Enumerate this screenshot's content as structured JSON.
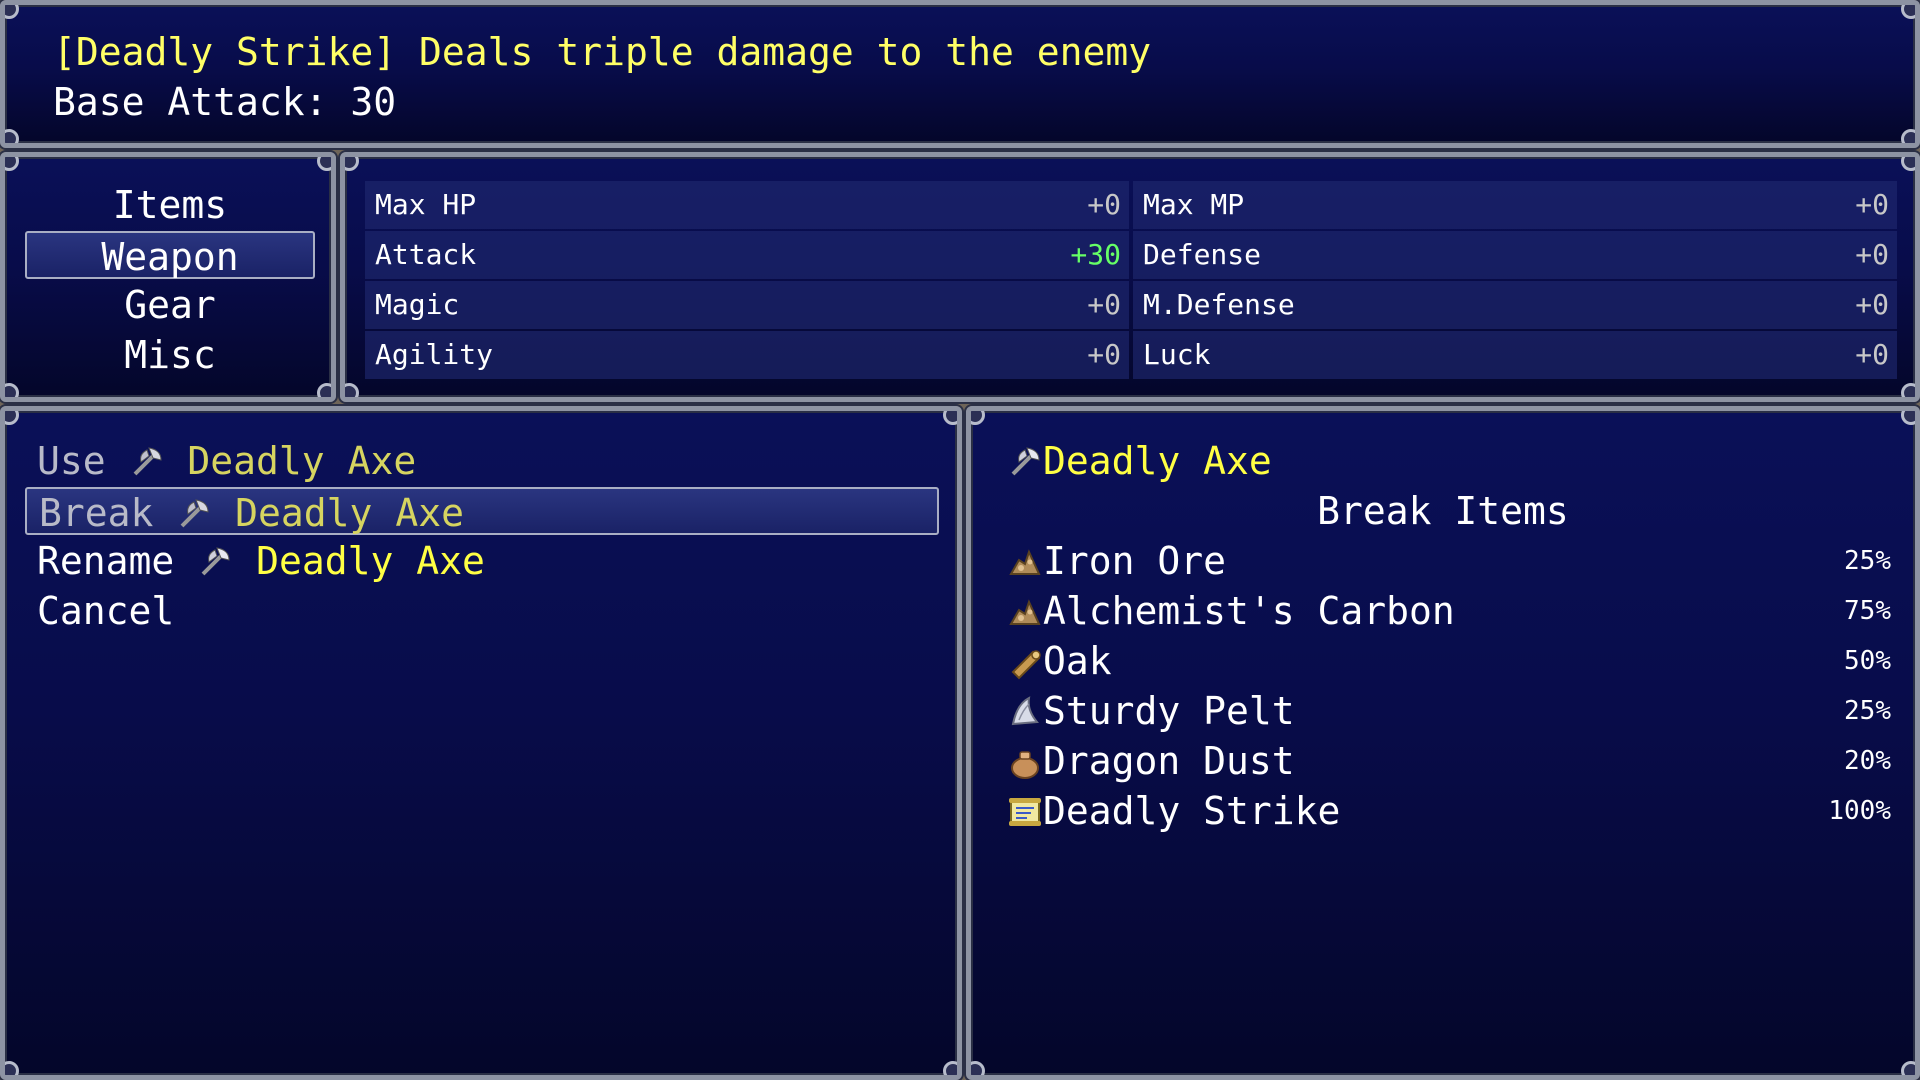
{
  "help": {
    "line1": "[Deadly Strike] Deals triple damage to the enemy",
    "line2": "Base Attack: 30"
  },
  "categories": [
    {
      "label": "Items",
      "selected": false
    },
    {
      "label": "Weapon",
      "selected": true
    },
    {
      "label": "Gear",
      "selected": false
    },
    {
      "label": "Misc",
      "selected": false
    }
  ],
  "stats": [
    {
      "name": "Max HP",
      "value": "+0"
    },
    {
      "name": "Max MP",
      "value": "+0"
    },
    {
      "name": "Attack",
      "value": "+30"
    },
    {
      "name": "Defense",
      "value": "+0"
    },
    {
      "name": "Magic",
      "value": "+0"
    },
    {
      "name": "M.Defense",
      "value": "+0"
    },
    {
      "name": "Agility",
      "value": "+0"
    },
    {
      "name": "Luck",
      "value": "+0"
    }
  ],
  "commands": [
    {
      "label": "Use",
      "item": "Deadly Axe",
      "icon": "axe-icon"
    },
    {
      "label": "Break",
      "item": "Deadly Axe",
      "icon": "axe-icon"
    },
    {
      "label": "Rename",
      "item": "Deadly Axe",
      "icon": "axe-icon"
    },
    {
      "label": "Cancel"
    }
  ],
  "info": {
    "item_name": "Deadly Axe",
    "item_icon": "axe-icon",
    "header": "Break Items",
    "drops": [
      {
        "name": "Iron Ore",
        "chance": "25%",
        "icon": "ore-icon"
      },
      {
        "name": "Alchemist's Carbon",
        "chance": "75%",
        "icon": "ore-icon"
      },
      {
        "name": "Oak",
        "chance": "50%",
        "icon": "log-icon"
      },
      {
        "name": "Sturdy Pelt",
        "chance": "25%",
        "icon": "pelt-icon"
      },
      {
        "name": "Dragon Dust",
        "chance": "20%",
        "icon": "pouch-icon"
      },
      {
        "name": "Deadly Strike",
        "chance": "100%",
        "icon": "scroll-icon"
      }
    ]
  },
  "colors": {
    "highlight_text": "#ffff44",
    "stat_increase": "#66ff66",
    "window_top": "#0a1058",
    "window_bottom": "#04062a"
  }
}
